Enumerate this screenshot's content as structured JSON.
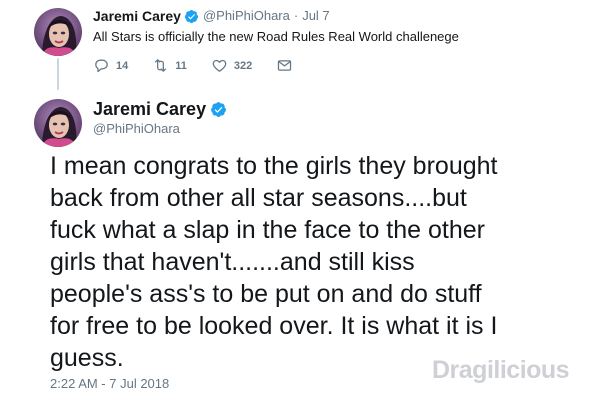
{
  "parent_tweet": {
    "author_name": "Jaremi Carey",
    "handle": "@PhiPhiOhara",
    "separator": "·",
    "date": "Jul 7",
    "text": "All Stars is officially the new Road Rules Real World challenege",
    "actions": {
      "reply_count": "14",
      "retweet_count": "11",
      "like_count": "322"
    }
  },
  "main_tweet": {
    "author_name": "Jaremi Carey",
    "handle": "@PhiPhiOhara",
    "body_lines": [
      "I mean congrats to the girls they brought",
      "back from other all star seasons....but",
      "fuck what a slap in the face to the other",
      "girls that haven't.......and still kiss",
      "people's ass's to be put on and do stuff",
      "for free to be looked over. It is what it is I",
      "guess."
    ],
    "timestamp": "2:22 AM - 7 Jul 2018"
  },
  "watermark": {
    "text": "Dragilicious"
  },
  "colors": {
    "verified_blue": "#1da1f2",
    "muted_text": "#657786",
    "thread_line": "#c6d7e3",
    "watermark": "#c9ccd1"
  },
  "icons": {
    "reply": "reply-icon",
    "retweet": "retweet-icon",
    "like": "heart-icon",
    "dm": "envelope-icon",
    "verified": "verified-badge-icon"
  }
}
